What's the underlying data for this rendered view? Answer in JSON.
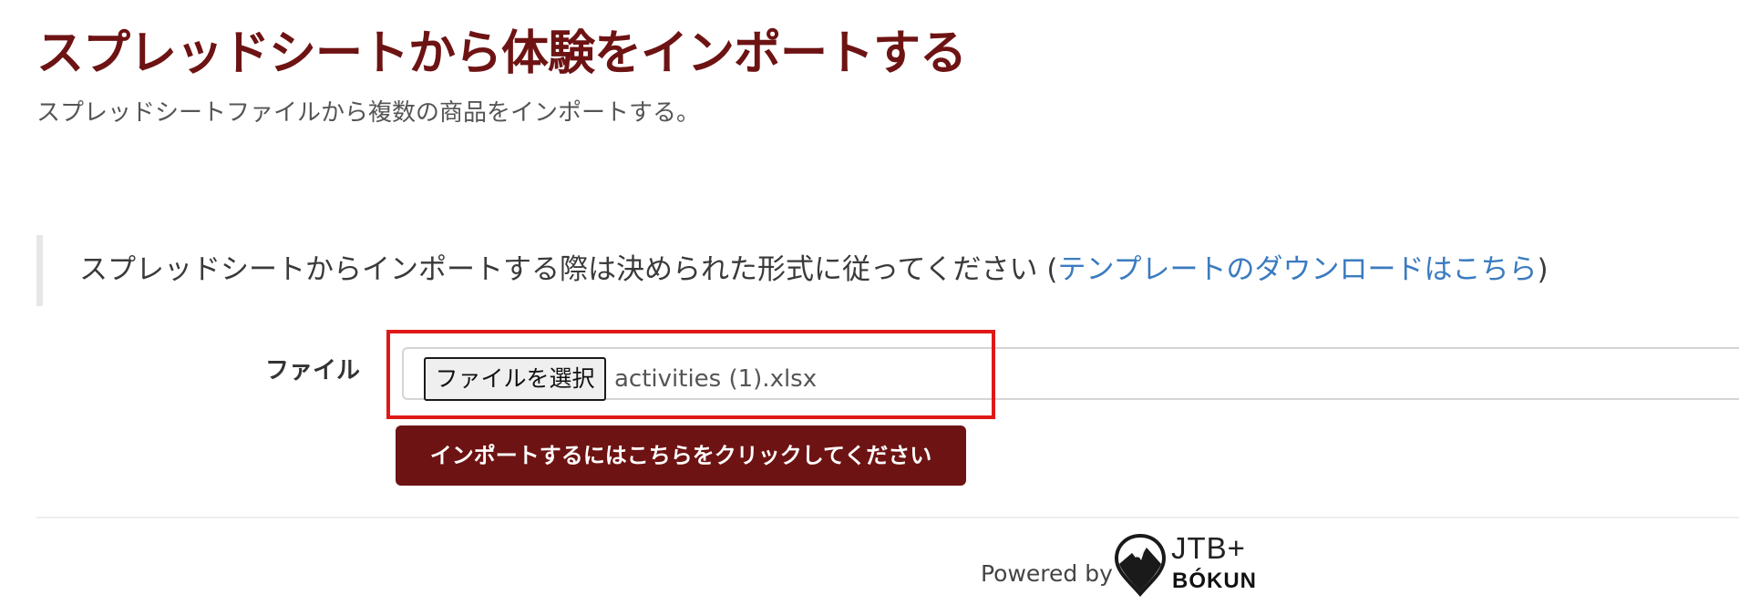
{
  "header": {
    "title": "スプレッドシートから体験をインポートする",
    "subtitle": "スプレッドシートファイルから複数の商品をインポートする。"
  },
  "notice": {
    "text": "スプレッドシートからインポートする際は決められた形式に従ってください (",
    "link_label": "テンプレートのダウンロードはこちら",
    "text_after": ")"
  },
  "form": {
    "file_label": "ファイル",
    "choose_file_button": "ファイルを選択",
    "selected_file_name": "activities (1).xlsx",
    "import_button": "インポートするにはこちらをクリックしてください"
  },
  "footer": {
    "powered_by": "Powered by",
    "brand_top": "JTB+",
    "brand_bottom": "BÓKUN",
    "brand_icon": "mountain-pin-logo-icon"
  },
  "colors": {
    "accent": "#6e1313",
    "link": "#3b7bbf",
    "highlight": "#e01818"
  }
}
